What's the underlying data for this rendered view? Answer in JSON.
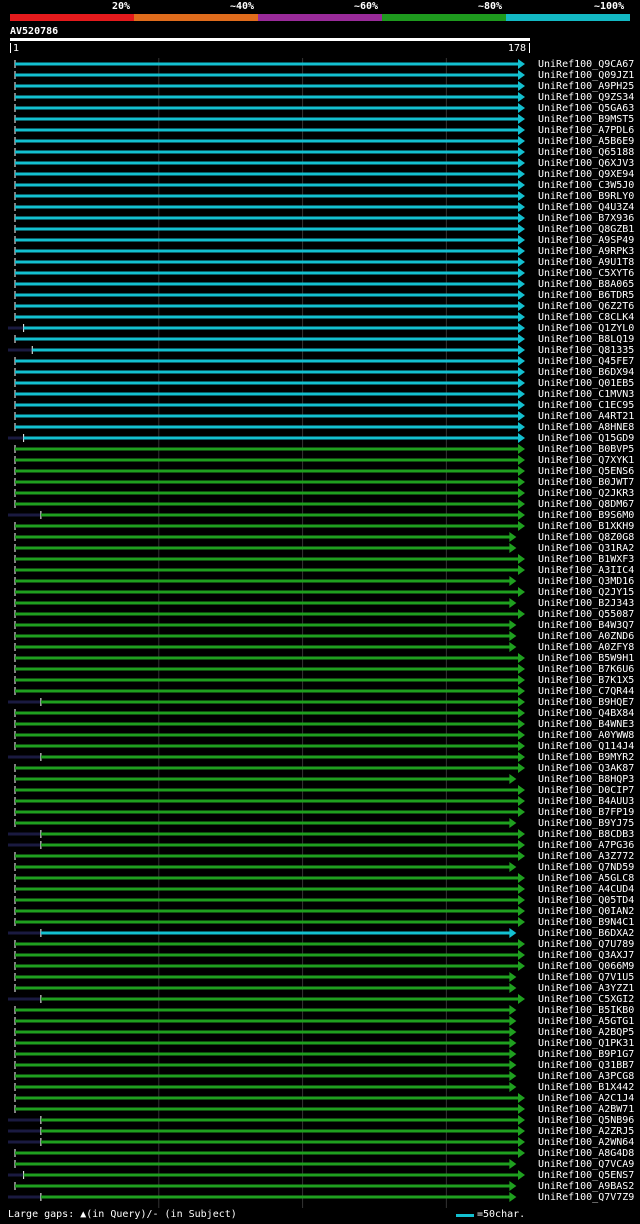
{
  "header": {
    "scale": [
      {
        "label": "20%",
        "color": "#e41a1c"
      },
      {
        "label": "~40%",
        "color": "#e06c1c"
      },
      {
        "label": "~60%",
        "color": "#9a2b9a"
      },
      {
        "label": "~80%",
        "color": "#1e9a1e"
      },
      {
        "label": "~100%",
        "color": "#13b9c4"
      }
    ],
    "query_id": "AV520786",
    "start": "1",
    "end": "178"
  },
  "colors": {
    "cyan": "#13c0d0",
    "green": "#1fa01f"
  },
  "hits": [
    {
      "id": "UniRef100_Q9CA67",
      "c": "cyan",
      "s": 1,
      "e": 178,
      "g": 0
    },
    {
      "id": "UniRef100_Q09JZ1",
      "c": "cyan",
      "s": 1,
      "e": 178,
      "g": 0
    },
    {
      "id": "UniRef100_A9PH25",
      "c": "cyan",
      "s": 1,
      "e": 178,
      "g": 0
    },
    {
      "id": "UniRef100_Q9ZS34",
      "c": "cyan",
      "s": 1,
      "e": 178,
      "g": 0
    },
    {
      "id": "UniRef100_Q5GA63",
      "c": "cyan",
      "s": 1,
      "e": 178,
      "g": 0
    },
    {
      "id": "UniRef100_B9MST5",
      "c": "cyan",
      "s": 1,
      "e": 178,
      "g": 0
    },
    {
      "id": "UniRef100_A7PDL6",
      "c": "cyan",
      "s": 1,
      "e": 178,
      "g": 0
    },
    {
      "id": "UniRef100_A5B6E9",
      "c": "cyan",
      "s": 1,
      "e": 178,
      "g": 0
    },
    {
      "id": "UniRef100_Q65188",
      "c": "cyan",
      "s": 1,
      "e": 178,
      "g": 0
    },
    {
      "id": "UniRef100_Q6XJV3",
      "c": "cyan",
      "s": 1,
      "e": 178,
      "g": 0
    },
    {
      "id": "UniRef100_Q9XE94",
      "c": "cyan",
      "s": 1,
      "e": 178,
      "g": 0
    },
    {
      "id": "UniRef100_C3W5J0",
      "c": "cyan",
      "s": 1,
      "e": 178,
      "g": 0
    },
    {
      "id": "UniRef100_B9RLY0",
      "c": "cyan",
      "s": 1,
      "e": 178,
      "g": 0
    },
    {
      "id": "UniRef100_Q4U3Z4",
      "c": "cyan",
      "s": 1,
      "e": 178,
      "g": 0
    },
    {
      "id": "UniRef100_B7X936",
      "c": "cyan",
      "s": 1,
      "e": 178,
      "g": 0
    },
    {
      "id": "UniRef100_Q8GZB1",
      "c": "cyan",
      "s": 1,
      "e": 178,
      "g": 0
    },
    {
      "id": "UniRef100_A9SP49",
      "c": "cyan",
      "s": 1,
      "e": 178,
      "g": 0
    },
    {
      "id": "UniRef100_A9RPK3",
      "c": "cyan",
      "s": 1,
      "e": 178,
      "g": 0
    },
    {
      "id": "UniRef100_A9U1T8",
      "c": "cyan",
      "s": 1,
      "e": 178,
      "g": 0
    },
    {
      "id": "UniRef100_C5XYT6",
      "c": "cyan",
      "s": 1,
      "e": 178,
      "g": 0
    },
    {
      "id": "UniRef100_B8A065",
      "c": "cyan",
      "s": 1,
      "e": 178,
      "g": 0
    },
    {
      "id": "UniRef100_B6TDR5",
      "c": "cyan",
      "s": 1,
      "e": 178,
      "g": 0
    },
    {
      "id": "UniRef100_Q6Z2T6",
      "c": "cyan",
      "s": 1,
      "e": 178,
      "g": 0
    },
    {
      "id": "UniRef100_C8CLK4",
      "c": "cyan",
      "s": 1,
      "e": 178,
      "g": 0
    },
    {
      "id": "UniRef100_Q1ZYL0",
      "c": "cyan",
      "s": 4,
      "e": 178,
      "g": 1
    },
    {
      "id": "UniRef100_B8LQ19",
      "c": "cyan",
      "s": 1,
      "e": 178,
      "g": 0
    },
    {
      "id": "UniRef100_Q81335",
      "c": "cyan",
      "s": 7,
      "e": 178,
      "g": 1
    },
    {
      "id": "UniRef100_Q45FE7",
      "c": "cyan",
      "s": 1,
      "e": 178,
      "g": 0
    },
    {
      "id": "UniRef100_B6DX94",
      "c": "cyan",
      "s": 1,
      "e": 178,
      "g": 0
    },
    {
      "id": "UniRef100_Q01EB5",
      "c": "cyan",
      "s": 1,
      "e": 178,
      "g": 0
    },
    {
      "id": "UniRef100_C1MVN3",
      "c": "cyan",
      "s": 1,
      "e": 178,
      "g": 0
    },
    {
      "id": "UniRef100_C1EC95",
      "c": "cyan",
      "s": 1,
      "e": 178,
      "g": 0
    },
    {
      "id": "UniRef100_A4RT21",
      "c": "cyan",
      "s": 1,
      "e": 178,
      "g": 0
    },
    {
      "id": "UniRef100_A8HNE8",
      "c": "cyan",
      "s": 1,
      "e": 178,
      "g": 0
    },
    {
      "id": "UniRef100_Q15GD9",
      "c": "cyan",
      "s": 4,
      "e": 178,
      "g": 1
    },
    {
      "id": "UniRef100_B0BVP5",
      "c": "green",
      "s": 1,
      "e": 178,
      "g": 0
    },
    {
      "id": "UniRef100_Q7XYK1",
      "c": "green",
      "s": 1,
      "e": 178,
      "g": 0
    },
    {
      "id": "UniRef100_Q5ENS6",
      "c": "green",
      "s": 1,
      "e": 178,
      "g": 0
    },
    {
      "id": "UniRef100_B0JWT7",
      "c": "green",
      "s": 1,
      "e": 178,
      "g": 0
    },
    {
      "id": "UniRef100_Q2JKR3",
      "c": "green",
      "s": 1,
      "e": 178,
      "g": 0
    },
    {
      "id": "UniRef100_Q8DM67",
      "c": "green",
      "s": 1,
      "e": 178,
      "g": 0
    },
    {
      "id": "UniRef100_B9S6M0",
      "c": "green",
      "s": 10,
      "e": 178,
      "g": 1
    },
    {
      "id": "UniRef100_B1XKH9",
      "c": "green",
      "s": 1,
      "e": 178,
      "g": 0
    },
    {
      "id": "UniRef100_Q8Z0G8",
      "c": "green",
      "s": 1,
      "e": 175,
      "g": 0
    },
    {
      "id": "UniRef100_Q31RA2",
      "c": "green",
      "s": 1,
      "e": 175,
      "g": 0
    },
    {
      "id": "UniRef100_B1WXF3",
      "c": "green",
      "s": 1,
      "e": 178,
      "g": 0
    },
    {
      "id": "UniRef100_A3IIC4",
      "c": "green",
      "s": 1,
      "e": 178,
      "g": 0
    },
    {
      "id": "UniRef100_Q3MD16",
      "c": "green",
      "s": 1,
      "e": 175,
      "g": 0
    },
    {
      "id": "UniRef100_Q2JY15",
      "c": "green",
      "s": 1,
      "e": 178,
      "g": 0
    },
    {
      "id": "UniRef100_B2J343",
      "c": "green",
      "s": 1,
      "e": 175,
      "g": 0
    },
    {
      "id": "UniRef100_Q55087",
      "c": "green",
      "s": 1,
      "e": 178,
      "g": 0
    },
    {
      "id": "UniRef100_B4W3Q7",
      "c": "green",
      "s": 1,
      "e": 175,
      "g": 0
    },
    {
      "id": "UniRef100_A0ZND6",
      "c": "green",
      "s": 1,
      "e": 175,
      "g": 0
    },
    {
      "id": "UniRef100_A0ZFY8",
      "c": "green",
      "s": 1,
      "e": 175,
      "g": 0
    },
    {
      "id": "UniRef100_B5W9H1",
      "c": "green",
      "s": 1,
      "e": 178,
      "g": 0
    },
    {
      "id": "UniRef100_B7K6U6",
      "c": "green",
      "s": 1,
      "e": 178,
      "g": 0
    },
    {
      "id": "UniRef100_B7K1X5",
      "c": "green",
      "s": 1,
      "e": 178,
      "g": 0
    },
    {
      "id": "UniRef100_C7QR44",
      "c": "green",
      "s": 1,
      "e": 178,
      "g": 0
    },
    {
      "id": "UniRef100_B9HQE7",
      "c": "green",
      "s": 10,
      "e": 178,
      "g": 1
    },
    {
      "id": "UniRef100_Q4BX84",
      "c": "green",
      "s": 1,
      "e": 178,
      "g": 0
    },
    {
      "id": "UniRef100_B4WNE3",
      "c": "green",
      "s": 1,
      "e": 178,
      "g": 0
    },
    {
      "id": "UniRef100_A0YWW8",
      "c": "green",
      "s": 1,
      "e": 178,
      "g": 0
    },
    {
      "id": "UniRef100_Q114J4",
      "c": "green",
      "s": 1,
      "e": 178,
      "g": 0
    },
    {
      "id": "UniRef100_B9MYR2",
      "c": "green",
      "s": 10,
      "e": 178,
      "g": 1
    },
    {
      "id": "UniRef100_Q3AK87",
      "c": "green",
      "s": 1,
      "e": 178,
      "g": 0
    },
    {
      "id": "UniRef100_B8HQP3",
      "c": "green",
      "s": 1,
      "e": 175,
      "g": 0
    },
    {
      "id": "UniRef100_D0CIP7",
      "c": "green",
      "s": 1,
      "e": 178,
      "g": 0
    },
    {
      "id": "UniRef100_B4AUU3",
      "c": "green",
      "s": 1,
      "e": 178,
      "g": 0
    },
    {
      "id": "UniRef100_B7FP19",
      "c": "green",
      "s": 1,
      "e": 178,
      "g": 0
    },
    {
      "id": "UniRef100_B9YJ75",
      "c": "green",
      "s": 1,
      "e": 175,
      "g": 0
    },
    {
      "id": "UniRef100_B8CDB3",
      "c": "green",
      "s": 10,
      "e": 178,
      "g": 1
    },
    {
      "id": "UniRef100_A7PG36",
      "c": "green",
      "s": 10,
      "e": 178,
      "g": 1
    },
    {
      "id": "UniRef100_A3Z772",
      "c": "green",
      "s": 1,
      "e": 178,
      "g": 0
    },
    {
      "id": "UniRef100_Q7ND59",
      "c": "green",
      "s": 1,
      "e": 175,
      "g": 0
    },
    {
      "id": "UniRef100_A5GLC8",
      "c": "green",
      "s": 1,
      "e": 178,
      "g": 0
    },
    {
      "id": "UniRef100_A4CUD4",
      "c": "green",
      "s": 1,
      "e": 178,
      "g": 0
    },
    {
      "id": "UniRef100_Q05TD4",
      "c": "green",
      "s": 1,
      "e": 178,
      "g": 0
    },
    {
      "id": "UniRef100_Q0IAN2",
      "c": "green",
      "s": 1,
      "e": 178,
      "g": 0
    },
    {
      "id": "UniRef100_B9N4C1",
      "c": "green",
      "s": 1,
      "e": 178,
      "g": 0
    },
    {
      "id": "UniRef100_B6DXA2",
      "c": "cyan",
      "s": 10,
      "e": 175,
      "g": 1
    },
    {
      "id": "UniRef100_Q7U789",
      "c": "green",
      "s": 1,
      "e": 178,
      "g": 0
    },
    {
      "id": "UniRef100_Q3AXJ7",
      "c": "green",
      "s": 1,
      "e": 178,
      "g": 0
    },
    {
      "id": "UniRef100_Q066M9",
      "c": "green",
      "s": 1,
      "e": 178,
      "g": 0
    },
    {
      "id": "UniRef100_Q7V1U5",
      "c": "green",
      "s": 1,
      "e": 175,
      "g": 0
    },
    {
      "id": "UniRef100_A3YZZ1",
      "c": "green",
      "s": 1,
      "e": 175,
      "g": 0
    },
    {
      "id": "UniRef100_C5XGI2",
      "c": "green",
      "s": 10,
      "e": 178,
      "g": 1
    },
    {
      "id": "UniRef100_B5IKB0",
      "c": "green",
      "s": 1,
      "e": 175,
      "g": 0
    },
    {
      "id": "UniRef100_A5GTG1",
      "c": "green",
      "s": 1,
      "e": 175,
      "g": 0
    },
    {
      "id": "UniRef100_A2BQP5",
      "c": "green",
      "s": 1,
      "e": 175,
      "g": 0
    },
    {
      "id": "UniRef100_Q1PK31",
      "c": "green",
      "s": 1,
      "e": 175,
      "g": 0
    },
    {
      "id": "UniRef100_B9P1G7",
      "c": "green",
      "s": 1,
      "e": 175,
      "g": 0
    },
    {
      "id": "UniRef100_Q31BB7",
      "c": "green",
      "s": 1,
      "e": 175,
      "g": 0
    },
    {
      "id": "UniRef100_A3PCG8",
      "c": "green",
      "s": 1,
      "e": 175,
      "g": 0
    },
    {
      "id": "UniRef100_B1X442",
      "c": "green",
      "s": 1,
      "e": 175,
      "g": 0
    },
    {
      "id": "UniRef100_A2C1J4",
      "c": "green",
      "s": 1,
      "e": 178,
      "g": 0
    },
    {
      "id": "UniRef100_A2BW71",
      "c": "green",
      "s": 1,
      "e": 178,
      "g": 0
    },
    {
      "id": "UniRef100_Q5NB96",
      "c": "green",
      "s": 10,
      "e": 178,
      "g": 1
    },
    {
      "id": "UniRef100_A2ZRJ5",
      "c": "green",
      "s": 10,
      "e": 178,
      "g": 1
    },
    {
      "id": "UniRef100_A2WN64",
      "c": "green",
      "s": 10,
      "e": 178,
      "g": 1
    },
    {
      "id": "UniRef100_A8G4D8",
      "c": "green",
      "s": 1,
      "e": 178,
      "g": 0
    },
    {
      "id": "UniRef100_Q7VCA9",
      "c": "green",
      "s": 1,
      "e": 175,
      "g": 0
    },
    {
      "id": "UniRef100_Q5ENS7",
      "c": "green",
      "s": 4,
      "e": 178,
      "g": 1
    },
    {
      "id": "UniRef100_A9BAS2",
      "c": "green",
      "s": 1,
      "e": 175,
      "g": 0
    },
    {
      "id": "UniRef100_Q7V7Z9",
      "c": "green",
      "s": 10,
      "e": 175,
      "g": 1
    }
  ],
  "footer": {
    "gaps_text": "Large gaps: ▲(in Query)/- (in Subject)",
    "legend_text": "=50char."
  }
}
